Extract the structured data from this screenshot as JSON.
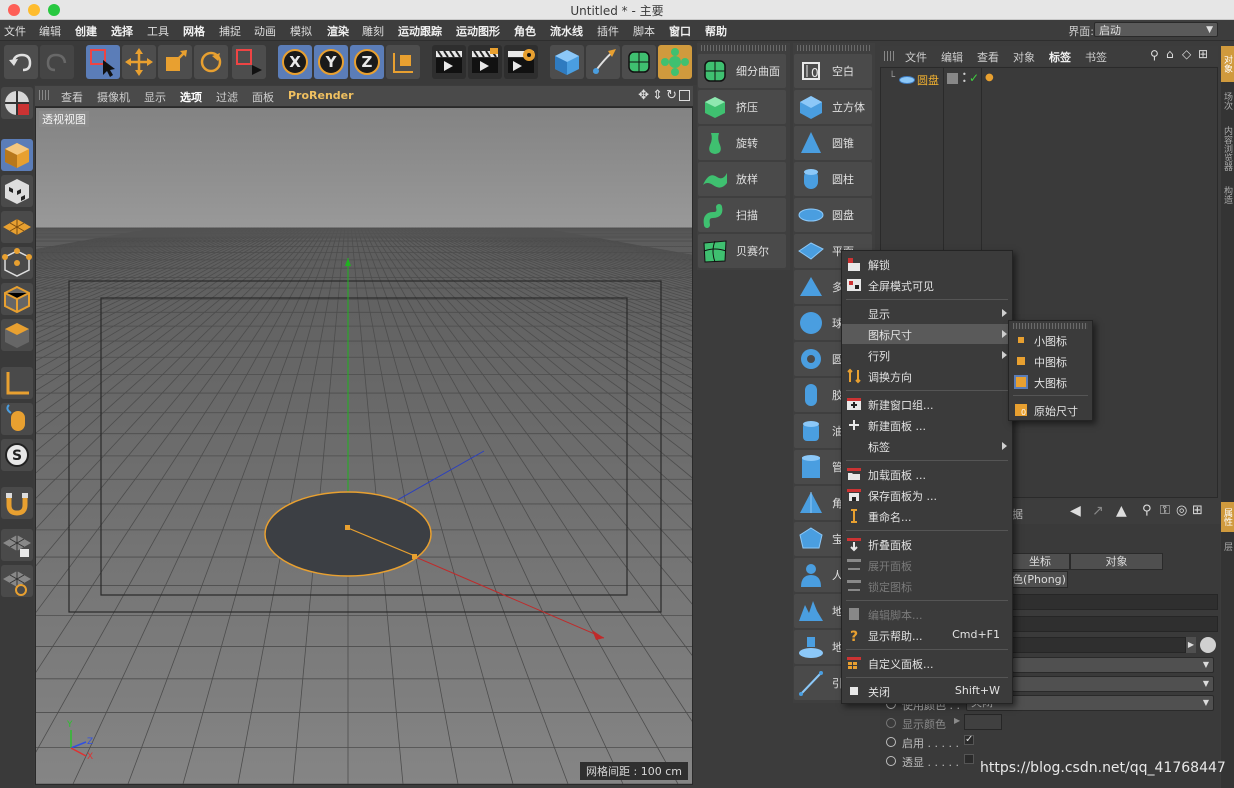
{
  "window": {
    "title": "Untitled * - 主要"
  },
  "menubar": {
    "items": [
      "文件",
      "编辑",
      "创建",
      "选择",
      "工具",
      "网格",
      "捕捉",
      "动画",
      "模拟",
      "渲染",
      "雕刻",
      "运动跟踪",
      "运动图形",
      "角色",
      "流水线",
      "插件",
      "脚本",
      "窗口",
      "帮助"
    ],
    "layout_label": "界面:",
    "layout_value": "启动"
  },
  "viewport": {
    "menu": [
      "查看",
      "摄像机",
      "显示",
      "选项",
      "过滤",
      "面板",
      "ProRender"
    ],
    "active_menu": "选项",
    "view_label": "透视视图",
    "grid_spacing": "网格间距 : 100 cm",
    "axis_labels": [
      "Y",
      "Z",
      "X"
    ]
  },
  "palette_generators": [
    "细分曲面",
    "挤压",
    "旋转",
    "放样",
    "扫描",
    "贝赛尔"
  ],
  "palette_primitives": [
    "空白",
    "立方体",
    "圆锥",
    "圆柱",
    "圆盘",
    "平面",
    "多",
    "球",
    "圆",
    "胶",
    "油",
    "管",
    "角",
    "宝",
    "人",
    "地",
    "地",
    "引"
  ],
  "object_manager": {
    "menu": [
      "文件",
      "编辑",
      "查看",
      "对象",
      "标签",
      "书签"
    ],
    "active_menu": "标签",
    "objects": [
      {
        "name": "圆盘"
      }
    ]
  },
  "right_tabs": [
    "对象",
    "场次",
    "内容浏览器",
    "构造"
  ],
  "right_tabs_bottom": [
    "属性",
    "层"
  ],
  "attribute_manager": {
    "partial_title": "据",
    "tab_coord": "坐标",
    "tab_object": "对象",
    "tab_phong": "色(Phong)",
    "label_use_color": "使用颜色 . .",
    "use_color_value": "关闭",
    "label_display_color": "显示颜色",
    "label_enable": "启用 . . . . .",
    "label_xray": "透显 . . . . ."
  },
  "context_menu": {
    "items": [
      {
        "label": "解锁",
        "icon": "unlock-icon"
      },
      {
        "label": "全屏模式可见",
        "icon": "fullscreen-icon"
      },
      {
        "sep": true
      },
      {
        "label": "显示",
        "submenu": true
      },
      {
        "label": "图标尺寸",
        "submenu": true,
        "highlighted": true
      },
      {
        "label": "行列",
        "submenu": true
      },
      {
        "label": "调换方向",
        "icon": "swap-icon"
      },
      {
        "sep": true
      },
      {
        "label": "新建窗口组...",
        "icon": "new-window-group-icon"
      },
      {
        "label": "新建面板 ...",
        "icon": "new-panel-icon"
      },
      {
        "label": "标签",
        "submenu": true
      },
      {
        "sep": true
      },
      {
        "label": "加载面板 ...",
        "icon": "load-panel-icon"
      },
      {
        "label": "保存面板为 ...",
        "icon": "save-panel-icon"
      },
      {
        "label": "重命名...",
        "icon": "rename-icon"
      },
      {
        "sep": true
      },
      {
        "label": "折叠面板",
        "icon": "fold-panel-icon"
      },
      {
        "label": "展开面板",
        "icon": "unfold-panel-icon",
        "disabled": true
      },
      {
        "label": "锁定图标",
        "icon": "lock-icon",
        "disabled": true
      },
      {
        "sep": true
      },
      {
        "label": "编辑脚本...",
        "icon": "edit-script-icon",
        "disabled": true
      },
      {
        "label": "显示帮助...",
        "icon": "help-icon",
        "shortcut": "Cmd+F1"
      },
      {
        "sep": true
      },
      {
        "label": "自定义面板...",
        "icon": "custom-panel-icon"
      },
      {
        "sep": true
      },
      {
        "label": "关闭",
        "icon": "close-icon",
        "shortcut": "Shift+W"
      }
    ]
  },
  "submenu": {
    "items": [
      {
        "label": "小图标"
      },
      {
        "label": "中图标"
      },
      {
        "label": "大图标",
        "checked": true
      },
      {
        "label": "原始尺寸"
      }
    ]
  },
  "watermark": "https://blog.csdn.net/qq_41768447"
}
